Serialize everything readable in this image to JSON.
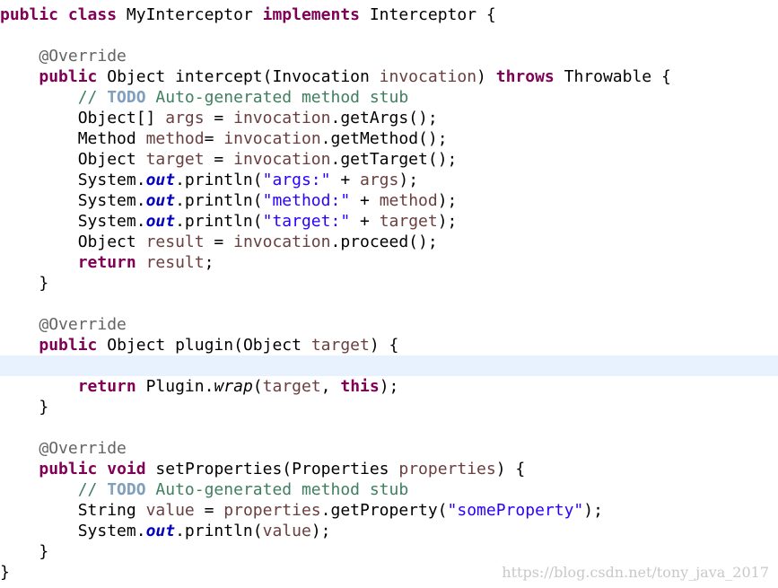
{
  "code_lines": [
    [
      {
        "t": "public",
        "k": "kw"
      },
      {
        "t": " "
      },
      {
        "t": "class",
        "k": "kw"
      },
      {
        "t": " MyInterceptor "
      },
      {
        "t": "implements",
        "k": "kw"
      },
      {
        "t": " Interceptor {"
      }
    ],
    [],
    [
      {
        "t": "    "
      },
      {
        "t": "@Override",
        "k": "ann"
      }
    ],
    [
      {
        "t": "    "
      },
      {
        "t": "public",
        "k": "kw"
      },
      {
        "t": " Object intercept(Invocation "
      },
      {
        "t": "invocation",
        "k": "var"
      },
      {
        "t": ") "
      },
      {
        "t": "throws",
        "k": "kw"
      },
      {
        "t": " Throwable {"
      }
    ],
    [
      {
        "t": "        "
      },
      {
        "t": "// ",
        "k": "cmt"
      },
      {
        "t": "TODO",
        "k": "todo"
      },
      {
        "t": " Auto-generated method stub",
        "k": "cmt"
      }
    ],
    [
      {
        "t": "        Object[] "
      },
      {
        "t": "args",
        "k": "var"
      },
      {
        "t": " = "
      },
      {
        "t": "invocation",
        "k": "var"
      },
      {
        "t": ".getArgs();"
      }
    ],
    [
      {
        "t": "        Method "
      },
      {
        "t": "method",
        "k": "var"
      },
      {
        "t": "= "
      },
      {
        "t": "invocation",
        "k": "var"
      },
      {
        "t": ".getMethod();"
      }
    ],
    [
      {
        "t": "        Object "
      },
      {
        "t": "target",
        "k": "var"
      },
      {
        "t": " = "
      },
      {
        "t": "invocation",
        "k": "var"
      },
      {
        "t": ".getTarget();"
      }
    ],
    [
      {
        "t": "        System."
      },
      {
        "t": "out",
        "k": "fld"
      },
      {
        "t": ".println("
      },
      {
        "t": "\"args:\"",
        "k": "str"
      },
      {
        "t": " + "
      },
      {
        "t": "args",
        "k": "var"
      },
      {
        "t": ");"
      }
    ],
    [
      {
        "t": "        System."
      },
      {
        "t": "out",
        "k": "fld"
      },
      {
        "t": ".println("
      },
      {
        "t": "\"method:\"",
        "k": "str"
      },
      {
        "t": " + "
      },
      {
        "t": "method",
        "k": "var"
      },
      {
        "t": ");"
      }
    ],
    [
      {
        "t": "        System."
      },
      {
        "t": "out",
        "k": "fld"
      },
      {
        "t": ".println("
      },
      {
        "t": "\"target:\"",
        "k": "str"
      },
      {
        "t": " + "
      },
      {
        "t": "target",
        "k": "var"
      },
      {
        "t": ");"
      }
    ],
    [
      {
        "t": "        Object "
      },
      {
        "t": "result",
        "k": "var"
      },
      {
        "t": " = "
      },
      {
        "t": "invocation",
        "k": "var"
      },
      {
        "t": ".proceed();"
      }
    ],
    [
      {
        "t": "        "
      },
      {
        "t": "return",
        "k": "kw"
      },
      {
        "t": " "
      },
      {
        "t": "result",
        "k": "var"
      },
      {
        "t": ";"
      }
    ],
    [
      {
        "t": "    }"
      }
    ],
    [],
    [
      {
        "t": "    "
      },
      {
        "t": "@Override",
        "k": "ann"
      }
    ],
    [
      {
        "t": "    "
      },
      {
        "t": "public",
        "k": "kw"
      },
      {
        "t": " Object plugin(Object "
      },
      {
        "t": "target",
        "k": "var"
      },
      {
        "t": ") {"
      }
    ],
    [],
    [
      {
        "t": "        "
      },
      {
        "t": "return",
        "k": "kw"
      },
      {
        "t": " Plugin."
      },
      {
        "t": "wrap",
        "k": "smeth"
      },
      {
        "t": "("
      },
      {
        "t": "target",
        "k": "var"
      },
      {
        "t": ", "
      },
      {
        "t": "this",
        "k": "kw"
      },
      {
        "t": ");"
      }
    ],
    [
      {
        "t": "    }"
      }
    ],
    [],
    [
      {
        "t": "    "
      },
      {
        "t": "@Override",
        "k": "ann"
      }
    ],
    [
      {
        "t": "    "
      },
      {
        "t": "public",
        "k": "kw"
      },
      {
        "t": " "
      },
      {
        "t": "void",
        "k": "kw"
      },
      {
        "t": " setProperties(Properties "
      },
      {
        "t": "properties",
        "k": "var"
      },
      {
        "t": ") {"
      }
    ],
    [
      {
        "t": "        "
      },
      {
        "t": "// ",
        "k": "cmt"
      },
      {
        "t": "TODO",
        "k": "todo"
      },
      {
        "t": " Auto-generated method stub",
        "k": "cmt"
      }
    ],
    [
      {
        "t": "        String "
      },
      {
        "t": "value",
        "k": "var"
      },
      {
        "t": " = "
      },
      {
        "t": "properties",
        "k": "var"
      },
      {
        "t": ".getProperty("
      },
      {
        "t": "\"someProperty\"",
        "k": "str"
      },
      {
        "t": ");"
      }
    ],
    [
      {
        "t": "        System."
      },
      {
        "t": "out",
        "k": "fld"
      },
      {
        "t": ".println("
      },
      {
        "t": "value",
        "k": "var"
      },
      {
        "t": ");"
      }
    ],
    [
      {
        "t": "    }"
      }
    ],
    [
      {
        "t": "}"
      }
    ]
  ],
  "current_line_index": 17,
  "watermark": "https://blog.csdn.net/tony_java_2017",
  "colors": {
    "keyword": "#7f0055",
    "annotation": "#646464",
    "variable": "#6a3e3e",
    "string": "#2a00ff",
    "static_field": "#0000c0",
    "comment": "#3f7f5f",
    "todo": "#7f9fbf",
    "current_line_highlight": "#e8f2fe"
  }
}
